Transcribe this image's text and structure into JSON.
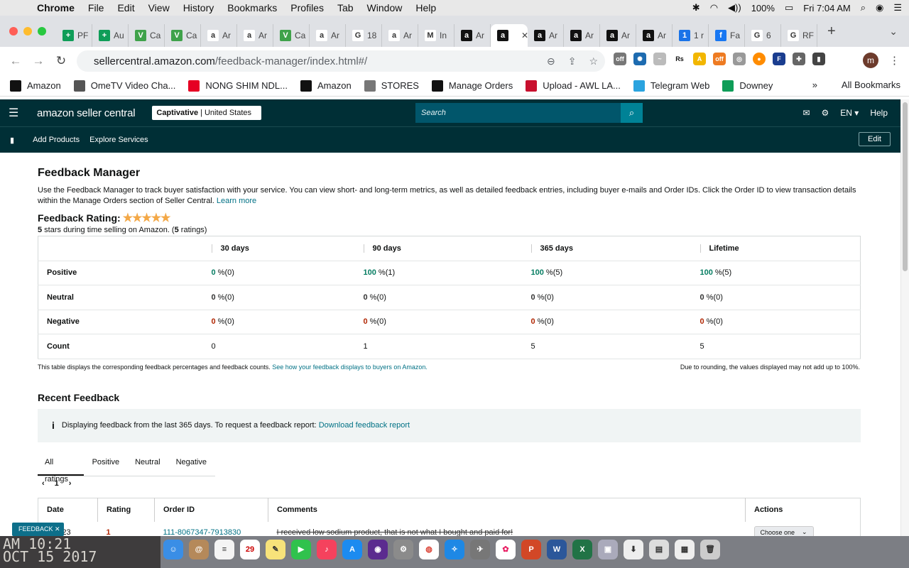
{
  "menubar": {
    "app": "Chrome",
    "items": [
      "File",
      "Edit",
      "View",
      "History",
      "Bookmarks",
      "Profiles",
      "Tab",
      "Window",
      "Help"
    ],
    "battery": "100%",
    "clock": "Fri 7:04 AM"
  },
  "tabs": [
    {
      "label": "PF",
      "icon": "sheets-icon",
      "color": "#0f9d58",
      "glyph": "+"
    },
    {
      "label": "Au",
      "icon": "sheets-icon",
      "color": "#0f9d58",
      "glyph": "+"
    },
    {
      "label": "Ca",
      "icon": "vine-icon",
      "color": "#3fa24a",
      "glyph": "V"
    },
    {
      "label": "Ca",
      "icon": "vine-icon",
      "color": "#3fa24a",
      "glyph": "V"
    },
    {
      "label": "Ar",
      "icon": "amazon-icon",
      "color": "#ffffff",
      "glyph": "a"
    },
    {
      "label": "Ar",
      "icon": "amazon-icon",
      "color": "#ffffff",
      "glyph": "a"
    },
    {
      "label": "Ca",
      "icon": "vine-icon",
      "color": "#3fa24a",
      "glyph": "V"
    },
    {
      "label": "Ar",
      "icon": "amazon-icon",
      "color": "#ffffff",
      "glyph": "a"
    },
    {
      "label": "18",
      "icon": "google-icon",
      "color": "#ffffff",
      "glyph": "G"
    },
    {
      "label": "Ar",
      "icon": "amazon-icon",
      "color": "#ffffff",
      "glyph": "a"
    },
    {
      "label": "In",
      "icon": "gmail-icon",
      "color": "#ffffff",
      "glyph": "M"
    },
    {
      "label": "Ar",
      "icon": "amazon-black-icon",
      "color": "#111111",
      "glyph": "a"
    },
    {
      "label": "",
      "icon": "amazon-black-icon",
      "color": "#111111",
      "glyph": "a",
      "active": true
    },
    {
      "label": "Ar",
      "icon": "amazon-black-icon",
      "color": "#111111",
      "glyph": "a"
    },
    {
      "label": "Ar",
      "icon": "amazon-black-icon",
      "color": "#111111",
      "glyph": "a"
    },
    {
      "label": "Ar",
      "icon": "amazon-black-icon",
      "color": "#111111",
      "glyph": "a"
    },
    {
      "label": "Ar",
      "icon": "amazon-black-icon",
      "color": "#111111",
      "glyph": "a"
    },
    {
      "label": "1 r",
      "icon": "info-blue-icon",
      "color": "#1a73e8",
      "glyph": "1"
    },
    {
      "label": "Fa",
      "icon": "facebook-icon",
      "color": "#1877f2",
      "glyph": "f"
    },
    {
      "label": "6",
      "icon": "google-icon",
      "color": "#ffffff",
      "glyph": "G"
    },
    {
      "label": "RF",
      "icon": "google-icon",
      "color": "#ffffff",
      "glyph": "G"
    }
  ],
  "url": {
    "host": "sellercentral.amazon.com",
    "path": "/feedback-manager/index.html#/"
  },
  "bookmarks": [
    {
      "label": "Amazon",
      "icon": "amazon-black-icon"
    },
    {
      "label": "OmeTV Video Cha...",
      "icon": "globe-icon"
    },
    {
      "label": "NONG SHIM NDL...",
      "icon": "pinterest-icon"
    },
    {
      "label": "Amazon",
      "icon": "amazon-black-icon"
    },
    {
      "label": "STORES",
      "icon": "folder-icon"
    },
    {
      "label": "Manage Orders",
      "icon": "amazon-black-icon"
    },
    {
      "label": "Upload - AWL LA...",
      "icon": "awl-icon"
    },
    {
      "label": "Telegram Web",
      "icon": "telegram-icon"
    },
    {
      "label": "Downey",
      "icon": "sheets-icon"
    }
  ],
  "bookmarks_more": "»",
  "all_bookmarks": "All Bookmarks",
  "seller": {
    "logo": "amazon seller central",
    "account_name": "Captivative",
    "account_region": "| United States",
    "search_placeholder": "Search",
    "lang": "EN",
    "help": "Help",
    "nav": [
      "Add Products",
      "Explore Services"
    ],
    "edit": "Edit"
  },
  "page": {
    "title": "Feedback Manager",
    "description": "Use the Feedback Manager to track buyer satisfaction with your service. You can view short- and long-term metrics, as well as detailed feedback entries, including buyer e-mails and Order IDs. Click the Order ID to view transaction details within the Manage Orders section of Seller Central.",
    "learn_more": "Learn more",
    "rating_label": "Feedback Rating:",
    "stars": "★★★★★",
    "rating_value": "5",
    "rating_mid": " stars during time selling on Amazon. (",
    "rating_count": "5",
    "rating_end": " ratings)"
  },
  "summary": {
    "columns": [
      "30 days",
      "90 days",
      "365 days",
      "Lifetime"
    ],
    "rows": [
      {
        "label": "Positive",
        "cls": "green",
        "values": [
          [
            "0",
            " %(0)"
          ],
          [
            "100",
            " %(1)"
          ],
          [
            "100",
            " %(5)"
          ],
          [
            "100",
            " %(5)"
          ]
        ]
      },
      {
        "label": "Neutral",
        "cls": "gray",
        "values": [
          [
            "0",
            " %(0)"
          ],
          [
            "0",
            " %(0)"
          ],
          [
            "0",
            " %(0)"
          ],
          [
            "0",
            " %(0)"
          ]
        ]
      },
      {
        "label": "Negative",
        "cls": "red",
        "values": [
          [
            "0",
            " %(0)"
          ],
          [
            "0",
            " %(0)"
          ],
          [
            "0",
            " %(0)"
          ],
          [
            "0",
            " %(0)"
          ]
        ]
      },
      {
        "label": "Count",
        "cls": "",
        "values": [
          [
            "0",
            ""
          ],
          [
            "1",
            ""
          ],
          [
            "5",
            ""
          ],
          [
            "5",
            ""
          ]
        ]
      }
    ],
    "note_left": "This table displays the corresponding feedback percentages and feedback counts.",
    "note_link": "See how your feedback displays to buyers on Amazon.",
    "note_right": "Due to rounding, the values displayed may not add up to 100%."
  },
  "recent": {
    "title": "Recent Feedback",
    "info": "Displaying feedback from the last 365 days. To request a feedback report:",
    "info_link": "Download feedback report",
    "filters": [
      "All ratings",
      "Positive",
      "Neutral",
      "Negative"
    ],
    "page": "1",
    "columns": [
      "Date",
      "Rating",
      "Order ID",
      "Comments",
      "Actions"
    ],
    "rows": [
      {
        "date": "4/2023",
        "rating": "1",
        "order_id": "111-8067347-7913830",
        "comment": "I received low sodium product, that is not what I bought and paid for!",
        "action": "Choose one"
      }
    ],
    "feedback_tag": "FEEDBACK ✕"
  },
  "desktop_stamp": "AM 10:21\nOCT 15 2017"
}
